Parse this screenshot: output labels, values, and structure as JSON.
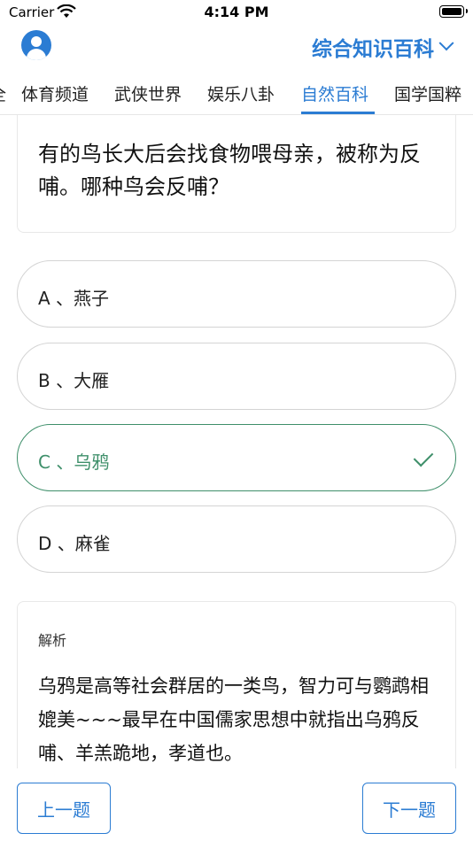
{
  "status_bar": {
    "carrier": "Carrier",
    "time": "4:14 PM"
  },
  "header": {
    "category": "综合知识百科"
  },
  "tabs": [
    {
      "label": "全"
    },
    {
      "label": "体育频道"
    },
    {
      "label": "武侠世界"
    },
    {
      "label": "娱乐八卦"
    },
    {
      "label": "自然百科"
    },
    {
      "label": "国学国粹"
    }
  ],
  "active_tab": "自然百科",
  "question": {
    "text": "有的鸟长大后会找食物喂母亲，被称为反哺。哪种鸟会反哺？"
  },
  "options": [
    {
      "label": "A 、燕子"
    },
    {
      "label": "B 、大雁"
    },
    {
      "label": "C 、乌鸦"
    },
    {
      "label": "D 、麻雀"
    }
  ],
  "correct_option": "C 、乌鸦",
  "analysis": {
    "title": "解析",
    "text": "乌鸦是高等社会群居的一类鸟，智力可与鹦鹉相媲美~~~最早在中国儒家思想中就指出乌鸦反哺、羊羔跪地，孝道也。"
  },
  "nav": {
    "prev_label": "上一题",
    "next_label": "下一题"
  },
  "colors": {
    "accent": "#2b7cd3",
    "correct": "#3e8f6a"
  }
}
